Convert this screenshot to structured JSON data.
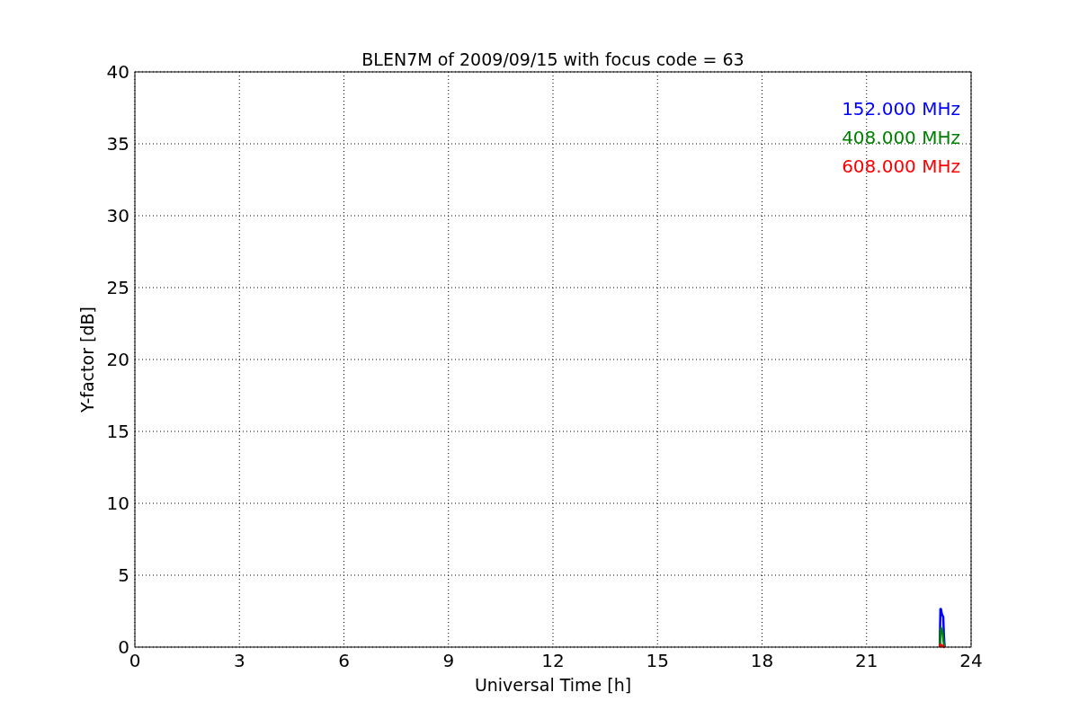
{
  "chart_data": {
    "type": "line",
    "title": "BLEN7M of 2009/09/15 with focus code = 63",
    "xlabel": "Universal Time [h]",
    "ylabel": "Y-factor [dB]",
    "x": [
      23.1,
      23.12,
      23.14,
      23.16,
      23.18,
      23.2,
      23.22,
      23.24
    ],
    "series": [
      {
        "name": "152.000 MHz",
        "color": "#0000ff",
        "values": [
          0,
          2.7,
          2.6,
          2.3,
          2.2,
          2.1,
          0.8,
          0
        ]
      },
      {
        "name": "408.000 MHz",
        "color": "#008000",
        "values": [
          0,
          1.1,
          1.3,
          1.2,
          1.0,
          0.6,
          0.2,
          0
        ]
      },
      {
        "name": "608.000 MHz",
        "color": "#ff0000",
        "values": [
          0,
          0.15,
          0.15,
          0.1,
          0.1,
          0.05,
          0,
          0
        ]
      }
    ],
    "xlim": [
      0,
      24
    ],
    "ylim": [
      0,
      40
    ],
    "xticks": [
      0,
      3,
      6,
      9,
      12,
      15,
      18,
      21,
      24
    ],
    "yticks": [
      0,
      5,
      10,
      15,
      20,
      25,
      30,
      35,
      40
    ],
    "grid": true
  }
}
